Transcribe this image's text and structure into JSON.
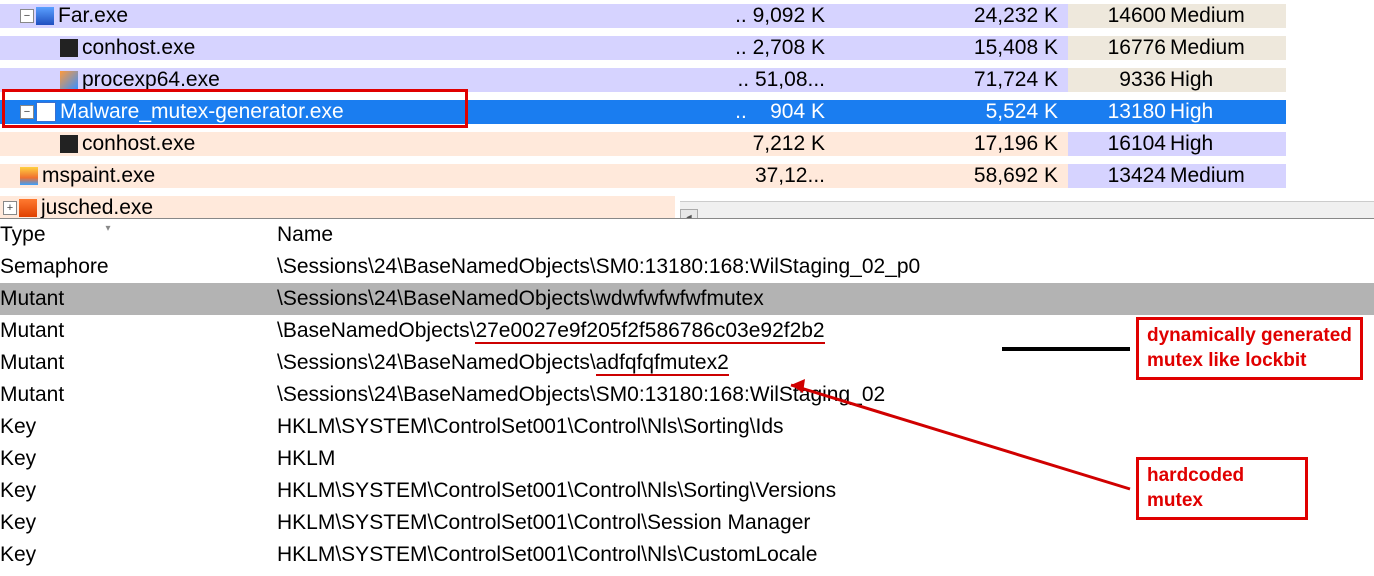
{
  "processes": [
    {
      "indent": 20,
      "toggle": "minus",
      "icon": "blue",
      "name": "Far.exe",
      "priv": ".. 9,092 K",
      "ws": "24,232 K",
      "pid": "14600",
      "prio": "Medium",
      "bg": "#d6d3ff",
      "pidbg": "#eee8dc"
    },
    {
      "indent": 60,
      "toggle": "",
      "icon": "cmd",
      "name": "conhost.exe",
      "priv": ".. 2,708 K",
      "ws": "15,408 K",
      "pid": "16776",
      "prio": "Medium",
      "bg": "#d6d3ff",
      "pidbg": "#eee8dc"
    },
    {
      "indent": 60,
      "toggle": "",
      "icon": "pe",
      "name": "procexp64.exe",
      "priv": ".. 51,08...",
      "ws": "71,724 K",
      "pid": "9336",
      "prio": "High",
      "bg": "#d6d3ff",
      "pidbg": "#eee8dc"
    },
    {
      "indent": 20,
      "toggle": "minus",
      "icon": "app",
      "name": "Malware_mutex-generator.exe",
      "priv": "..    904 K",
      "ws": "5,524 K",
      "pid": "13180",
      "prio": "High",
      "bg": "#1a7df0",
      "pidbg": "#1a7df0",
      "selected": true
    },
    {
      "indent": 60,
      "toggle": "",
      "icon": "cmd",
      "name": "conhost.exe",
      "priv": "7,212 K",
      "ws": "17,196 K",
      "pid": "16104",
      "prio": "High",
      "bg": "#ffe9db",
      "pidbg": "#d6d3ff"
    },
    {
      "indent": 20,
      "toggle": "",
      "icon": "paint",
      "name": "mspaint.exe",
      "priv": "37,12...",
      "ws": "58,692 K",
      "pid": "13424",
      "prio": "Medium",
      "bg": "#ffe9db",
      "pidbg": "#d6d3ff"
    },
    {
      "indent": 3,
      "toggle": "plus",
      "icon": "java",
      "name": "jusched.exe",
      "priv": "",
      "ws": "",
      "pid": "",
      "prio": "",
      "bg": "#ffe9db",
      "pidbg": ""
    }
  ],
  "handle_headers": {
    "type": "Type",
    "name": "Name"
  },
  "handles": [
    {
      "type": "Semaphore",
      "name": "\\Sessions\\24\\BaseNamedObjects\\SM0:13180:168:WilStaging_02_p0"
    },
    {
      "type": "Mutant",
      "name": "\\Sessions\\24\\BaseNamedObjects\\wdwfwfwfwfmutex",
      "hl": true
    },
    {
      "type": "Mutant",
      "name": "\\BaseNamedObjects\\27e0027e9f205f2f586786c03e92f2b2",
      "u1": true
    },
    {
      "type": "Mutant",
      "name": "\\Sessions\\24\\BaseNamedObjects\\adfqfqfmutex2",
      "u2": true
    },
    {
      "type": "Mutant",
      "name": "\\Sessions\\24\\BaseNamedObjects\\SM0:13180:168:WilStaging_02"
    },
    {
      "type": "Key",
      "name": "HKLM\\SYSTEM\\ControlSet001\\Control\\Nls\\Sorting\\Ids"
    },
    {
      "type": "Key",
      "name": "HKLM"
    },
    {
      "type": "Key",
      "name": "HKLM\\SYSTEM\\ControlSet001\\Control\\Nls\\Sorting\\Versions"
    },
    {
      "type": "Key",
      "name": "HKLM\\SYSTEM\\ControlSet001\\Control\\Session Manager"
    },
    {
      "type": "Key",
      "name": "HKLM\\SYSTEM\\ControlSet001\\Control\\Nls\\CustomLocale"
    }
  ],
  "annotations": {
    "dyn": "dynamically generated mutex like lockbit",
    "hard": "hardcoded mutex"
  }
}
